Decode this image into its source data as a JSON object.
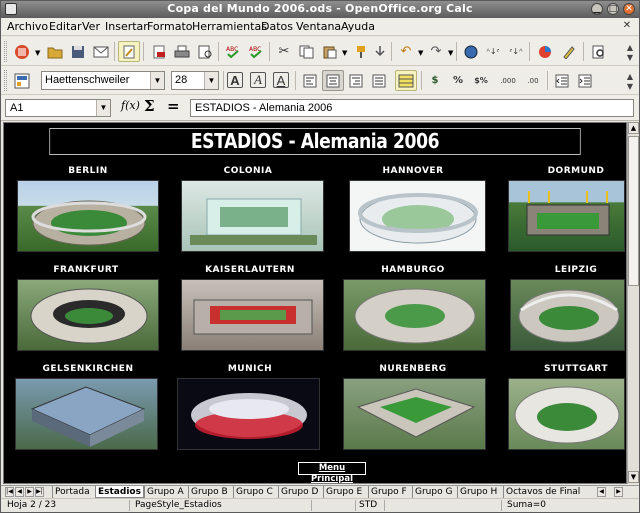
{
  "window": {
    "title": "Copa del Mundo 2006.ods - OpenOffice.org Calc",
    "btn_min": "▁",
    "btn_max": "□",
    "btn_close": "✕"
  },
  "menu": [
    "Archivo",
    "Editar",
    "Ver",
    "Insertar",
    "Formato",
    "Herramientas",
    "Datos",
    "Ventana",
    "Ayuda"
  ],
  "menu_close": "✕",
  "format_toolbar": {
    "font_name": "Haettenschweiler",
    "font_size": "28",
    "bold": "A",
    "italic": "A",
    "underline": "A"
  },
  "formula_bar": {
    "cell_ref": "A1",
    "fx": "f(x)",
    "sum": "Σ",
    "equals": "=",
    "content": "ESTADIOS - Alemania 2006"
  },
  "sheet": {
    "title": "ESTADIOS - Alemania 2006",
    "stadiums": [
      "BERLIN",
      "COLONIA",
      "HANNOVER",
      "DORMUND",
      "FRANKFURT",
      "KAISERLAUTERN",
      "HAMBURGO",
      "LEIPZIG",
      "GELSENKIRCHEN",
      "MUNICH",
      "NURENBERG",
      "STUTTGART"
    ],
    "menu_link": "Menu Principal"
  },
  "tabs": [
    "Portada",
    "Estadios",
    "Grupo A",
    "Grupo B",
    "Grupo C",
    "Grupo D",
    "Grupo E",
    "Grupo F",
    "Grupo G",
    "Grupo H",
    "Octavos de Final"
  ],
  "active_tab": "Estadios",
  "status": {
    "sheet": "Hoja 2 / 23",
    "page_style": "PageStyle_Estadios",
    "mode": "STD",
    "sum": "Suma=0"
  }
}
